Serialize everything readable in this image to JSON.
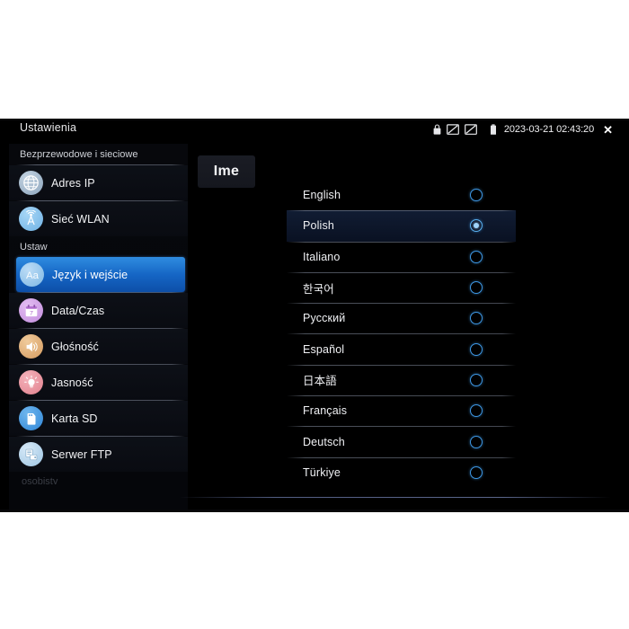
{
  "topbar": {
    "title": "Ustawienia",
    "timestamp": "2023-03-21 02:43:20",
    "close_label": "✕",
    "icons": [
      "lock-icon",
      "screen-off-icon",
      "screen-off-icon",
      "battery-icon"
    ]
  },
  "sidebar": {
    "sections": [
      {
        "header": "Bezprzewodowe i sieciowe",
        "items": [
          {
            "label": "Adres IP",
            "icon": "globe-icon",
            "icon_color": "#9fb4c9",
            "selected": false
          },
          {
            "label": "Sieć WLAN",
            "icon": "wifi-tower-icon",
            "icon_color": "#7fc2f0",
            "selected": false
          }
        ]
      },
      {
        "header": "Ustaw",
        "items": [
          {
            "label": "Język i wejście",
            "icon": "language-aa-icon",
            "icon_color": "#8fc3ef",
            "selected": true
          },
          {
            "label": "Data/Czas",
            "icon": "calendar-icon",
            "icon_color": "#cf9fe6",
            "selected": false
          },
          {
            "label": "Głośność",
            "icon": "speaker-icon",
            "icon_color": "#dfae78",
            "selected": false
          },
          {
            "label": "Jasność",
            "icon": "brightness-bulb-icon",
            "icon_color": "#e8909a",
            "selected": false
          },
          {
            "label": "Karta SD",
            "icon": "sd-card-icon",
            "icon_color": "#3f9ae8",
            "selected": false
          },
          {
            "label": "Serwer FTP",
            "icon": "server-icon",
            "icon_color": "#b9d6ee",
            "selected": false
          }
        ]
      }
    ],
    "cut_off_text": "osobisty"
  },
  "main": {
    "tab_label": "Ime",
    "languages": [
      {
        "label": "English",
        "selected": false
      },
      {
        "label": "Polish",
        "selected": true
      },
      {
        "label": "Italiano",
        "selected": false
      },
      {
        "label": "한국어",
        "selected": false
      },
      {
        "label": "Русский",
        "selected": false
      },
      {
        "label": "Español",
        "selected": false
      },
      {
        "label": "日本語",
        "selected": false
      },
      {
        "label": "Français",
        "selected": false
      },
      {
        "label": "Deutsch",
        "selected": false
      },
      {
        "label": "Türkiye",
        "selected": false
      }
    ]
  },
  "colors": {
    "accent": "#1565c4",
    "radio": "#3f9ae8",
    "screen_bg": "#000000",
    "page_bg": "#ffffff"
  }
}
